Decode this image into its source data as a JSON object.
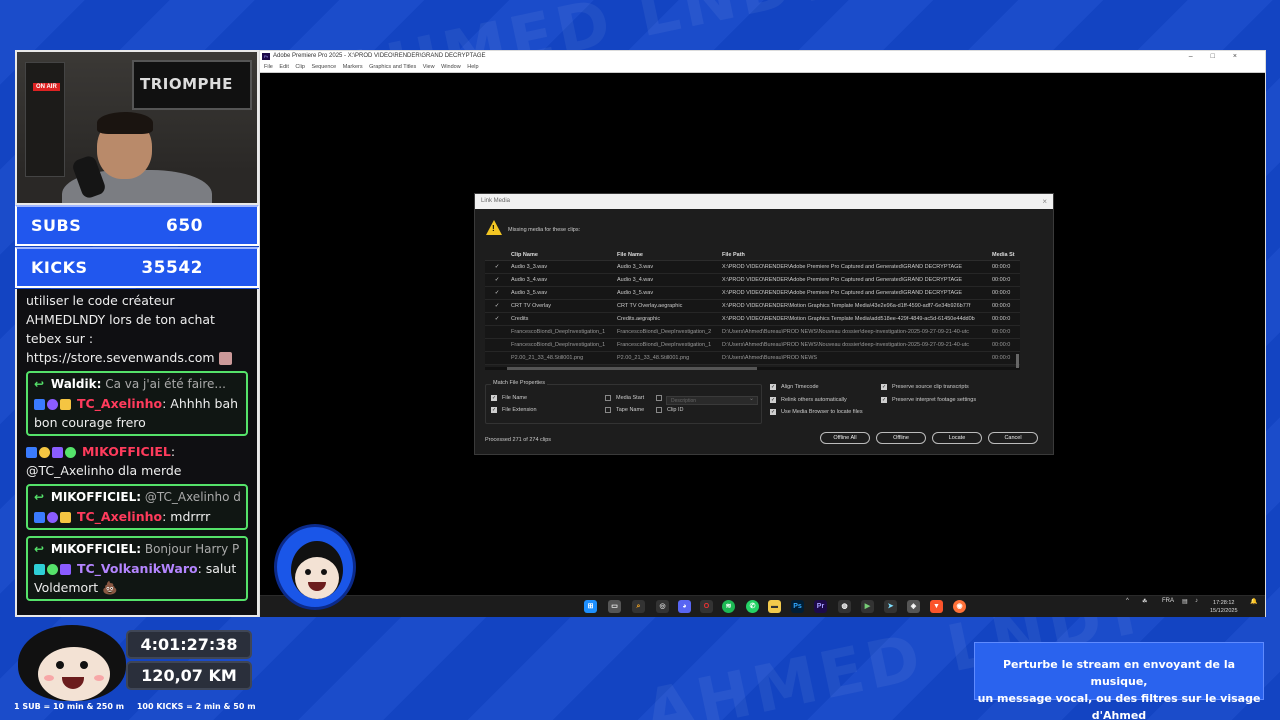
{
  "overlay": {
    "counters": {
      "subs_label": "SUBS",
      "subs_value": "650",
      "kicks_label": "KICKS",
      "kicks_value": "35542"
    },
    "webcam": {
      "poster_text": "TRIOMPHE",
      "onair": "ON AIR"
    },
    "stats": {
      "timer": "4:01:27:38",
      "distance": "120,07 KM"
    },
    "legend": {
      "subs": "1 SUB = 10 min & 250 m",
      "kicks": "100 KICKS = 2 min & 50 m"
    },
    "promo": {
      "line1": "Perturbe le stream en envoyant de la musique,",
      "line2": "un message vocal, ou des filtres sur le visage d'Ahmed"
    },
    "watermark": "AHMED LNDY"
  },
  "chat": {
    "intro": "utiliser le code créateur AHMEDLNDY lors de ton achat tebex sur : https://store.sevenwands.com",
    "messages": [
      {
        "reply_to": "Waldik:",
        "reply_ctx": "Ca va j'ai été faire...",
        "user": "TC_Axelinho",
        "text": ": Ahhhh bah bon courage frero"
      },
      {
        "user": "MIKOFFICIEL",
        "text": ": @TC_Axelinho dla merde"
      },
      {
        "reply_to": "MIKOFFICIEL:",
        "reply_ctx": "@TC_Axelinho dla...",
        "user": "TC_Axelinho",
        "text": ": mdrrrr"
      },
      {
        "reply_to": "MIKOFFICIEL:",
        "reply_ctx": "Bonjour Harry Plo...",
        "user": "TC_VolkanikWaro",
        "text": ": salut Voldemort 💩"
      }
    ]
  },
  "premiere": {
    "title": "Adobe Premiere Pro 2025 - X:\\PROD VIDEO\\RENDER\\GRAND DECRYPTAGE",
    "menu": [
      "File",
      "Edit",
      "Clip",
      "Sequence",
      "Markers",
      "Graphics and Titles",
      "View",
      "Window",
      "Help"
    ],
    "dialog": {
      "title": "Link Media",
      "message": "Missing media for these clips:",
      "columns": [
        "Clip Name",
        "File Name",
        "File Path",
        "Media St"
      ],
      "rows": [
        {
          "checked": true,
          "clip": "Audio 3_3.wav",
          "file": "Audio 3_3.wav",
          "path": "X:\\PROD VIDEO\\RENDER\\Adobe Premiere Pro Captured and Generated\\GRAND DECRYPTAGE",
          "ms": "00:00:0"
        },
        {
          "checked": true,
          "clip": "Audio 3_4.wav",
          "file": "Audio 3_4.wav",
          "path": "X:\\PROD VIDEO\\RENDER\\Adobe Premiere Pro Captured and Generated\\GRAND DECRYPTAGE",
          "ms": "00:00:0"
        },
        {
          "checked": true,
          "clip": "Audio 3_5.wav",
          "file": "Audio 3_5.wav",
          "path": "X:\\PROD VIDEO\\RENDER\\Adobe Premiere Pro Captured and Generated\\GRAND DECRYPTAGE",
          "ms": "00:00:0"
        },
        {
          "checked": true,
          "clip": "CRT TV Overlay",
          "file": "CRT TV Overlay.aegraphic",
          "path": "X:\\PROD VIDEO\\RENDER\\Motion Graphics Template Media\\43e2e96a-d1ff-4590-adf7-6e34b926b77f",
          "ms": "00:00:0"
        },
        {
          "checked": true,
          "clip": "Credits",
          "file": "Credits.aegraphic",
          "path": "X:\\PROD VIDEO\\RENDER\\Motion Graphics Template Media\\add518ee-429f-4849-ac5d-61450e44dd0b",
          "ms": "00:00:0"
        },
        {
          "checked": false,
          "clip": "FrancescoBiondi_DeepInvestigation_1",
          "file": "FrancescoBiondi_DeepInvestigation_2",
          "path": "D:\\Users\\Ahmed\\Bureau\\PROD NEWS\\Nouveau dossier\\deep-investigation-2025-09-27-09-21-40-utc",
          "ms": "00:00:0"
        },
        {
          "checked": false,
          "clip": "FrancescoBiondi_DeepInvestigation_1",
          "file": "FrancescoBiondi_DeepInvestigation_1",
          "path": "D:\\Users\\Ahmed\\Bureau\\PROD NEWS\\Nouveau dossier\\deep-investigation-2025-09-27-09-21-40-utc",
          "ms": "00:00:0"
        },
        {
          "checked": false,
          "clip": "P2.00_21_33_48.Still001.png",
          "file": "P2.00_21_33_48.Still001.png",
          "path": "D:\\Users\\Ahmed\\Bureau\\PROD NEWS",
          "ms": "00:00:0"
        }
      ],
      "match_title": "Match File Properties",
      "opt_file_name": "File Name",
      "opt_file_ext": "File Extension",
      "opt_media_start": "Media Start",
      "opt_tape_name": "Tape Name",
      "opt_description": "Description",
      "opt_clip_id": "Clip ID",
      "opt_align": "Align Timecode",
      "opt_relink": "Relink others automatically",
      "opt_browser": "Use Media Browser to locate files",
      "opt_transcripts": "Preserve source clip transcripts",
      "opt_interpret": "Preserve interpret footage settings",
      "processed": "Processed 271 of 274 clips",
      "btn_offline_all": "Offline All",
      "btn_offline": "Offline",
      "btn_locate": "Locate",
      "btn_cancel": "Cancel"
    },
    "taskbar": {
      "lang": "FRA",
      "time": "17:28:12",
      "date": "15/12/2025"
    }
  },
  "colors": {
    "brand_blue": "#1446c8",
    "accent_green": "#55e26a",
    "username_red": "#ff3b5c"
  }
}
